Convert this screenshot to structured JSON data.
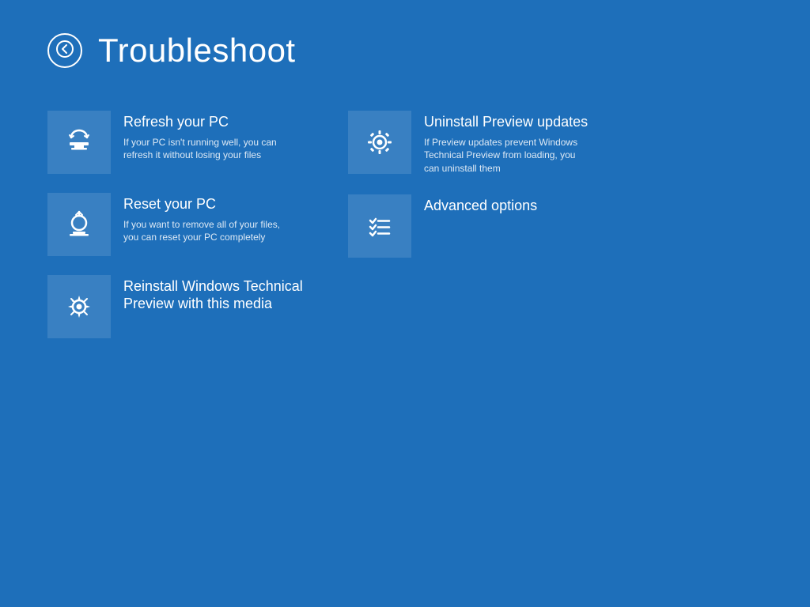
{
  "header": {
    "back_label": "←",
    "title": "Troubleshoot"
  },
  "options": {
    "left": [
      {
        "id": "refresh",
        "title": "Refresh your PC",
        "description": "If your PC isn't running well, you can refresh it without losing your files",
        "icon": "refresh"
      },
      {
        "id": "reset",
        "title": "Reset your PC",
        "description": "If you want to remove all of your files, you can reset your PC completely",
        "icon": "reset"
      },
      {
        "id": "reinstall",
        "title": "Reinstall Windows Technical Preview with this media",
        "description": "",
        "icon": "gear"
      }
    ],
    "right": [
      {
        "id": "uninstall",
        "title": "Uninstall Preview updates",
        "description": "If Preview updates prevent Windows Technical Preview from loading, you can uninstall them",
        "icon": "gear"
      },
      {
        "id": "advanced",
        "title": "Advanced options",
        "description": "",
        "icon": "checklist"
      }
    ]
  }
}
